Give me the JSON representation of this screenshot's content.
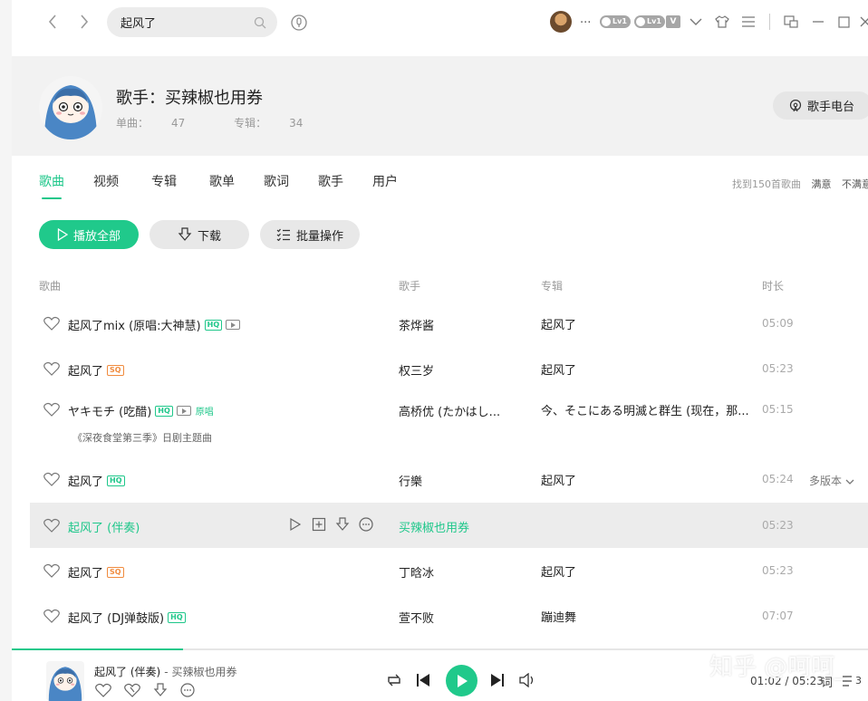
{
  "search": {
    "value": "起风了"
  },
  "topbar": {
    "user_dots": "...",
    "badge1": "Lv1",
    "badge2": "Lv1"
  },
  "artist": {
    "name": "歌手：买辣椒也用券",
    "singles_label": "单曲：",
    "singles": "47",
    "albums_label": "专辑：",
    "albums": "34",
    "radio_label": "歌手电台"
  },
  "tabs": [
    "歌曲",
    "视频",
    "专辑",
    "歌单",
    "歌词",
    "歌手",
    "用户"
  ],
  "found": {
    "text": "找到150首歌曲",
    "satisfied": "满意",
    "unsatisfied": "不满意"
  },
  "actions": {
    "play_all": "播放全部",
    "download": "下载",
    "batch": "批量操作"
  },
  "columns": {
    "song": "歌曲",
    "singer": "歌手",
    "album": "专辑",
    "duration": "时长"
  },
  "songs": [
    {
      "title": "起风了mix (原唱:大神慧)",
      "tags": [
        "HQ",
        "MV"
      ],
      "singer": "茶烨酱",
      "album": "起风了",
      "duration": "05:09"
    },
    {
      "title": "起风了",
      "tags": [
        "SQ"
      ],
      "singer": "权三岁",
      "album": "起风了",
      "duration": "05:23"
    },
    {
      "title": "ヤキモチ (吃醋)",
      "tags": [
        "HQ",
        "MV"
      ],
      "orig": "原唱",
      "subtitle": "《深夜食堂第三季》日剧主题曲",
      "singer": "高桥优 (たかはし...",
      "album": "今、そこにある明滅と群生 (现在，那...",
      "duration": "05:15"
    },
    {
      "title": "起风了",
      "tags": [
        "HQ"
      ],
      "singer": "行樂",
      "album": "起风了",
      "duration": "05:24",
      "multi": "多版本"
    },
    {
      "title": "起风了 (伴奏)",
      "tags": [],
      "singer": "买辣椒也用券",
      "album": "",
      "duration": "05:23",
      "highlight": true
    },
    {
      "title": "起风了",
      "tags": [
        "SQ"
      ],
      "singer": "丁晗冰",
      "album": "起风了",
      "duration": "05:23"
    },
    {
      "title": "起风了 (DJ弹鼓版)",
      "tags": [
        "HQ"
      ],
      "singer": "萱不败",
      "album": "蹦迪舞",
      "duration": "07:07"
    }
  ],
  "player": {
    "title": "起风了 (伴奏)",
    "separator": "-",
    "artist": "买辣椒也用券",
    "time": "01:02 / 05:23",
    "lyric": "词",
    "playlist_count": "3",
    "progress": 0.2
  },
  "watermark": "知乎 @呵呵_",
  "colors": {
    "accent": "#1ec78a",
    "sq": "#f08b3e"
  }
}
